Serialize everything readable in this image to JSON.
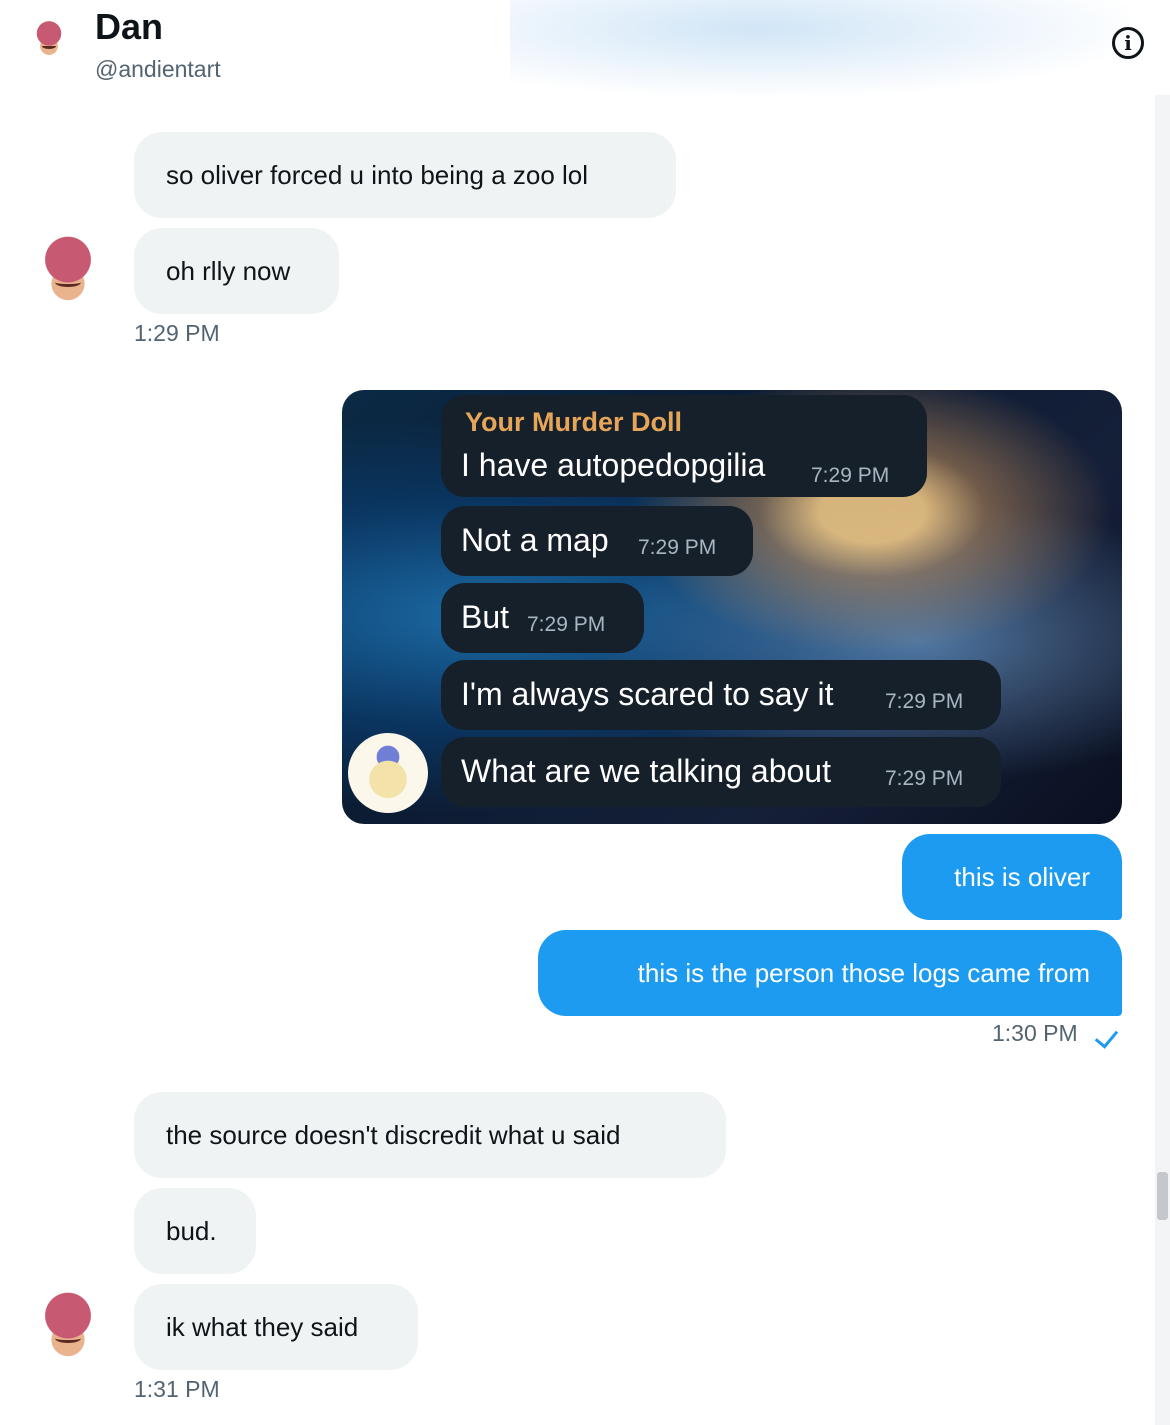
{
  "header": {
    "name": "Dan",
    "handle": "@andientart",
    "info_icon": "info-icon"
  },
  "messages": {
    "m1": "so oliver forced u into being a zoo lol",
    "m2": "oh rlly now",
    "t1": "1:29 PM",
    "o1": "this is oliver",
    "o2": "this is the person those logs came from",
    "t2": "1:30 PM",
    "m3": "the source doesn't discredit what u said",
    "m4": "bud.",
    "m5": "ik what they said",
    "t3": "1:31 PM"
  },
  "screenshot": {
    "sender": "Your Murder Doll",
    "lines": [
      {
        "text": "I have autopedopgilia",
        "time": "7:29 PM"
      },
      {
        "text": "Not a map",
        "time": "7:29 PM"
      },
      {
        "text": "But",
        "time": "7:29 PM"
      },
      {
        "text": "I'm always scared to say it",
        "time": "7:29 PM"
      },
      {
        "text": "What are we talking about",
        "time": "7:29 PM"
      }
    ]
  },
  "colors": {
    "outgoing": "#1d9bf0",
    "incoming": "#eff3f4",
    "telegram_bubble": "#15202a",
    "sender_name": "#e7a55a"
  }
}
